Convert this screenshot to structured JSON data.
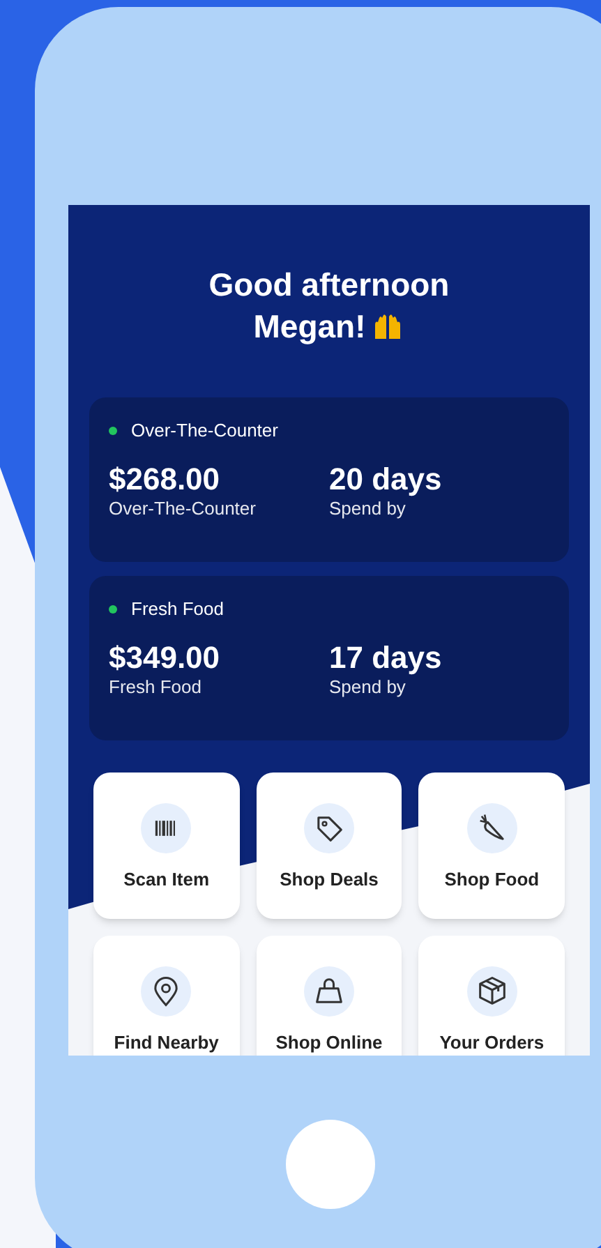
{
  "greeting": {
    "line_1": "Good afternoon",
    "line_2": "Megan!"
  },
  "benefits": [
    {
      "title": "Over-The-Counter",
      "color": "#22c55e",
      "amount": "$268.00",
      "amount_label": "Over-The-Counter",
      "days": "20 days",
      "days_label": "Spend by"
    },
    {
      "title": "Fresh Food",
      "color": "#22c55e",
      "amount": "$349.00",
      "amount_label": "Fresh Food",
      "days": "17 days",
      "days_label": "Spend by"
    }
  ],
  "actions": [
    {
      "label": "Scan Item"
    },
    {
      "label": "Shop Deals"
    },
    {
      "label": "Shop Food"
    },
    {
      "label": "Find Nearby"
    },
    {
      "label": "Shop Online"
    },
    {
      "label": "Your Orders"
    }
  ]
}
